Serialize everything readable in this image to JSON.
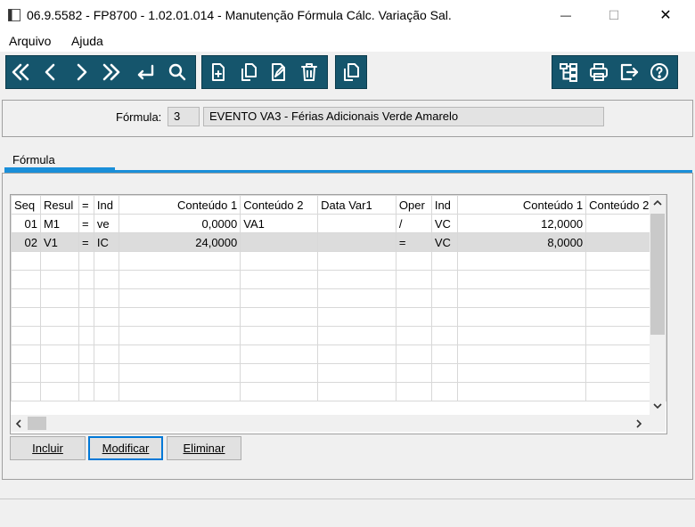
{
  "window": {
    "title": "06.9.5582 - FP8700 - 1.02.01.014 - Manutenção Fórmula Cálc. Variação Sal.",
    "minimize_glyph": "—",
    "maximize_glyph": "☐",
    "close_glyph": "✕"
  },
  "menu": {
    "items": [
      "Arquivo",
      "Ajuda"
    ]
  },
  "toolbar": {
    "icons": [
      "first-icon",
      "previous-icon",
      "next-icon",
      "last-icon",
      "return-icon",
      "search-icon",
      "new-record-icon",
      "copy-record-icon",
      "edit-record-icon",
      "delete-icon",
      "duplicate-icon",
      "structure-icon",
      "print-icon",
      "exit-icon",
      "help-icon"
    ],
    "color": "#15556c"
  },
  "header": {
    "formula_label": "Fórmula:",
    "formula_code": "3",
    "formula_description": "EVENTO VA3 - Férias Adicionais Verde Amarelo"
  },
  "tabs": [
    {
      "label": "Fórmula",
      "active": true
    }
  ],
  "grid": {
    "columns": [
      "Seq",
      "Resul",
      "=",
      "Ind",
      "Conteúdo 1",
      "Conteúdo 2",
      "Data Var1",
      "Oper",
      "Ind",
      "Conteúdo 1",
      "Conteúdo 2"
    ],
    "rows": [
      [
        "01",
        "M1",
        "=",
        "ve",
        "0,0000",
        "VA1",
        "",
        "/",
        "VC",
        "12,0000",
        ""
      ],
      [
        "02",
        "V1",
        "=",
        "IC",
        "24,0000",
        "",
        "",
        "=",
        "VC",
        "8,0000",
        ""
      ]
    ],
    "selected_row": 1,
    "empty_rows": 8
  },
  "buttons": {
    "include": "Incluir",
    "modify": "Modificar",
    "delete": "Eliminar"
  }
}
